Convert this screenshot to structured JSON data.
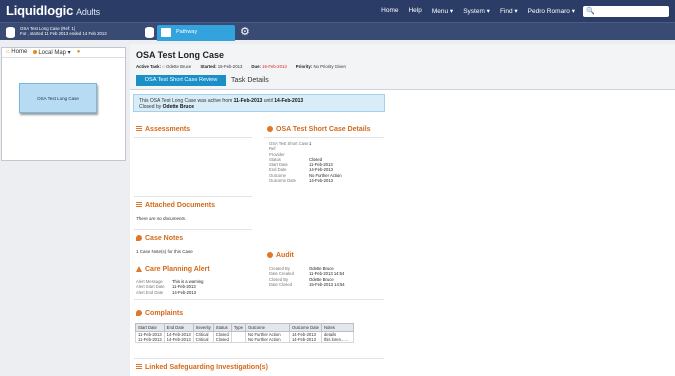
{
  "app": {
    "logo": "Liquidlogic",
    "name": "Adults"
  },
  "topnav": {
    "items": [
      "Home",
      "Help",
      "Menu ▾",
      "System ▾",
      "Find ▾",
      "Pedro Romaro ▾"
    ]
  },
  "casebar": {
    "line1": "OSA Test Long Case (Ref: 1)",
    "line2": "For , started 11 Feb 2013 ended 14 Feb 2013",
    "pathway": "Pathway"
  },
  "leftnav": {
    "home": "Home",
    "map": "Local Map ▾",
    "node": "OSA Test Long Case"
  },
  "header": {
    "title": "OSA Test Long Case",
    "active_task_label": "Active Task:",
    "active_task_value": "Odette Bruce",
    "started_label": "Started:",
    "started_value": "15-Feb-2013",
    "due_label": "Due:",
    "due_value": "15-Feb-2013",
    "priority_label": "Priority:",
    "priority_value": "No Priority Given",
    "tab_active": "OSA Test Short Case Review",
    "tab_other": "Task Details"
  },
  "banner": {
    "pre": "This OSA Test Long Case was active from ",
    "from": "11-Feb-2013",
    "mid": " until ",
    "to": "14-Feb-2013",
    "closed_pre": "Closed by ",
    "closed_by": "Odette Bruce"
  },
  "sections": {
    "assessments": "Assessments",
    "attached_docs": "Attached Documents",
    "no_docs": "There are no documents.",
    "case_notes": "Case Notes",
    "case_notes_link": "1 Case Note(s) for this Case",
    "short_case": "OSA Test Short Case Details",
    "audit": "Audit",
    "care_alert": "Care Planning Alert",
    "complaints": "Complaints",
    "safeguarding": "Linked Safeguarding Investigation(s)"
  },
  "short_case_details": [
    {
      "k": "OSA Test Short Case",
      "v": "1"
    },
    {
      "k": "Ref",
      "v": ""
    },
    {
      "k": "Provider",
      "v": ""
    },
    {
      "k": "Status",
      "v": "Closed"
    },
    {
      "k": "Start Date",
      "v": "11-Feb-2013"
    },
    {
      "k": "End Date",
      "v": "14-Feb-2013"
    },
    {
      "k": "Outcome",
      "v": "No Further Action"
    },
    {
      "k": "Outcome Date",
      "v": "14-Feb-2013"
    }
  ],
  "audit": [
    {
      "k": "Created By",
      "v": "Odette Bruce"
    },
    {
      "k": "Date Created",
      "v": "11-Feb-2013 14:54"
    },
    {
      "k": "Closed By",
      "v": "Odette Bruce"
    },
    {
      "k": "Date Closed",
      "v": "15-Feb-2013 14:54"
    }
  ],
  "care_alert": [
    {
      "k": "Alert Message",
      "v": "This is a warning"
    },
    {
      "k": "Alert Start Date",
      "v": "11-Feb-2013"
    },
    {
      "k": "Alert End Date",
      "v": "14-Feb-2013"
    }
  ],
  "complaints": {
    "headers": [
      "Start Date",
      "End Date",
      "Severity",
      "Status",
      "Type",
      "Outcome",
      "Outcome Date",
      "Notes"
    ],
    "rows": [
      [
        "11-Feb-2013",
        "14-Feb-2013",
        "Critical",
        "Closed",
        "",
        "No Further Action",
        "14-Feb-2013",
        "details"
      ],
      [
        "11-Feb-2013",
        "14-Feb-2013",
        "Critical",
        "Closed",
        "",
        "No Further Action",
        "14-Feb-2013",
        "this loren......"
      ]
    ]
  }
}
